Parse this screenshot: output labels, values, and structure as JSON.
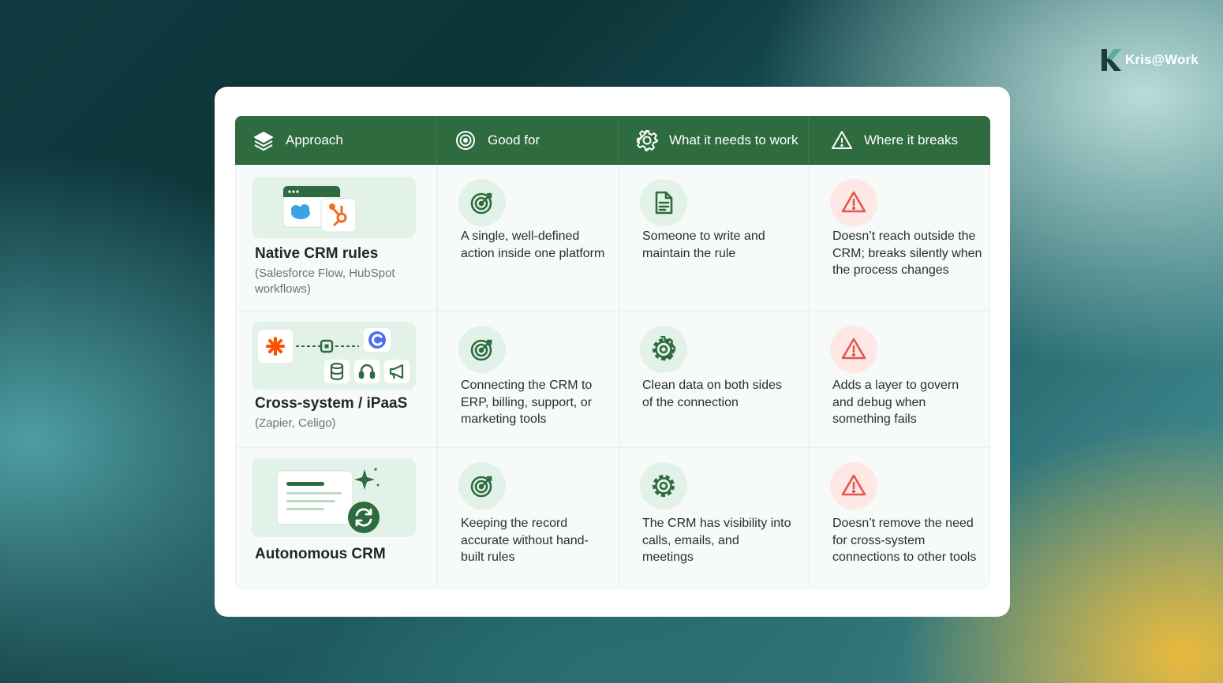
{
  "brand": {
    "name_part1": "Kris",
    "at": "@",
    "name_part2": "Work"
  },
  "header": {
    "col1": "Approach",
    "col2": "Good for",
    "col3": "What it needs to work",
    "col4": "Where it breaks"
  },
  "rows": [
    {
      "title": "Native CRM rules",
      "subtitle": "(Salesforce Flow, HubSpot workflows)",
      "good_for": "A single, well-defined action inside one platform",
      "needs": "Someone to write and maintain the rule",
      "breaks": "Doesn’t reach outside the CRM; breaks silently when the process changes"
    },
    {
      "title": "Cross-system / iPaaS",
      "subtitle": "(Zapier, Celigo)",
      "good_for": "Connecting the CRM to ERP, billing, support, or marketing tools",
      "needs": "Clean data on both sides of the connection",
      "breaks": "Adds a layer to govern and debug when something fails"
    },
    {
      "title": "Autonomous CRM",
      "good_for": "Keeping the record accurate without hand-built rules",
      "needs": "The CRM has visibility into calls, emails, and meetings",
      "breaks": "Doesn’t remove the need for cross-system connections to other tools"
    }
  ],
  "colors": {
    "header_bg": "#2e6b3f",
    "accent_green": "#2e6b3f",
    "warning_red": "#e2574c",
    "hubspot_orange": "#f26b21",
    "salesforce_blue": "#3aa3e3",
    "zapier_orange": "#ff4f00",
    "celigo_blue": "#4c6ef5"
  },
  "icons": {
    "approach": "layers-icon",
    "good_for": "target-icon",
    "needs": "gear-icon",
    "breaks": "warning-icon"
  }
}
